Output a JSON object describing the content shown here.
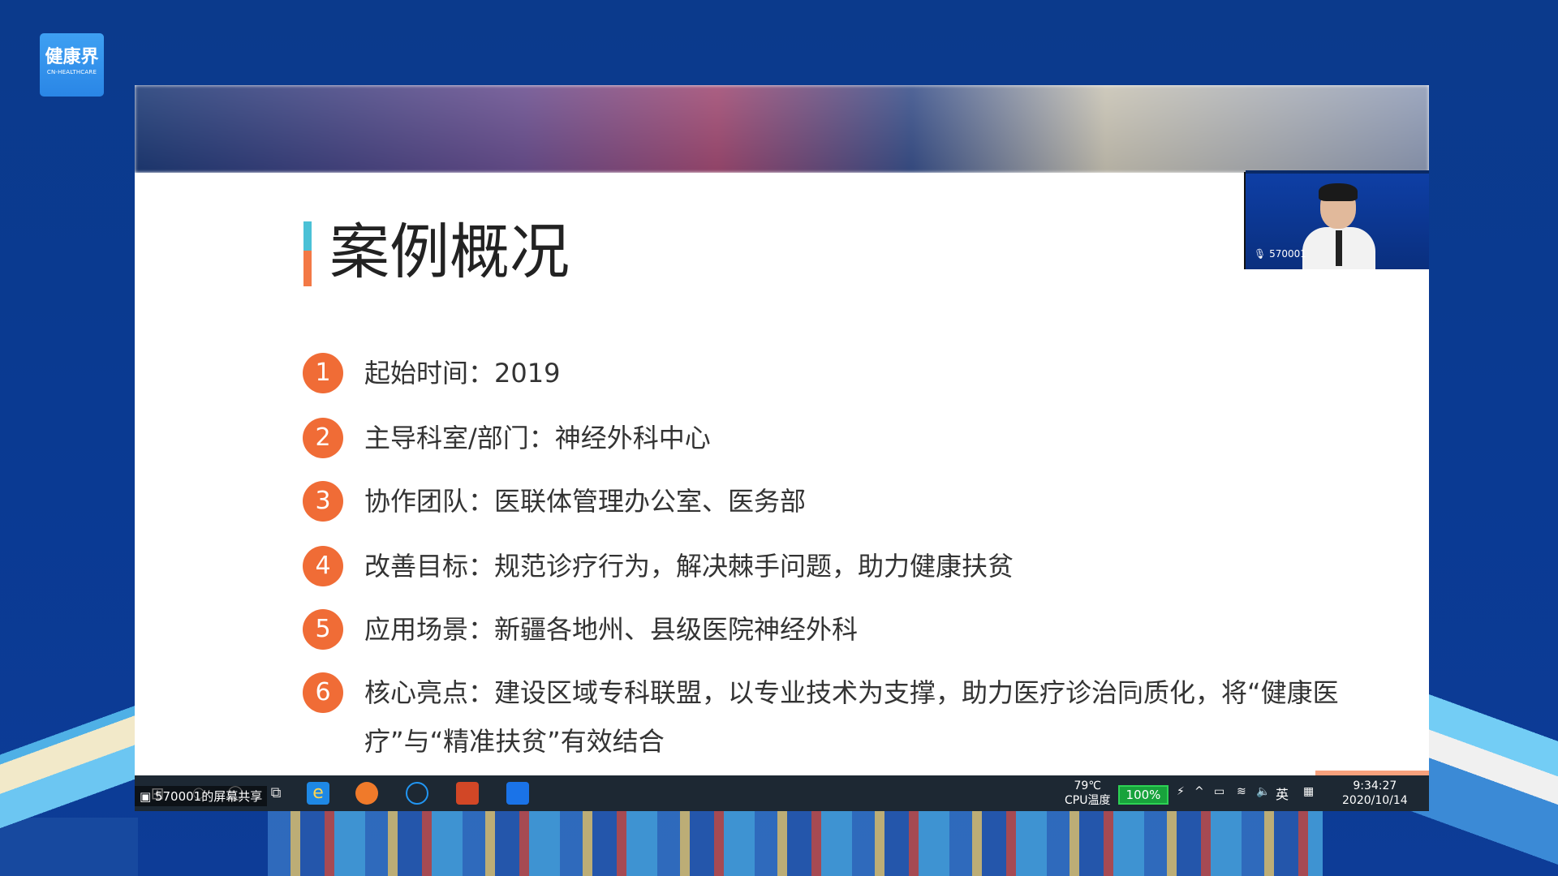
{
  "brand": {
    "name": "健康界",
    "sub": "CN-HEALTHCARE"
  },
  "slide": {
    "title": "案例概况",
    "items": [
      {
        "num": "1",
        "text": "起始时间：2019"
      },
      {
        "num": "2",
        "text": "主导科室/部门：神经外科中心"
      },
      {
        "num": "3",
        "text": "协作团队：医联体管理办公室、医务部"
      },
      {
        "num": "4",
        "text": "改善目标：规范诊疗行为，解决棘手问题，助力健康扶贫"
      },
      {
        "num": "5",
        "text": "应用场景：新疆各地州、县级医院神经外科"
      },
      {
        "num": "6",
        "text": "核心亮点：建设区域专科联盟，以专业技术为支撑，助力医疗诊治同质化，将“健康医疗”与“精准扶贫”有效结合"
      }
    ]
  },
  "video": {
    "user_id": "570001"
  },
  "taskbar": {
    "share_label": "570001的屏幕共享",
    "cpu_temp": "79℃",
    "cpu_label": "CPU温度",
    "battery": "100%",
    "ime": "英",
    "time": "9:34:27",
    "date": "2020/10/14"
  },
  "colors": {
    "accent_orange": "#f06c36",
    "accent_teal": "#4bc1d6",
    "background_blue": "#0b3a8c"
  }
}
